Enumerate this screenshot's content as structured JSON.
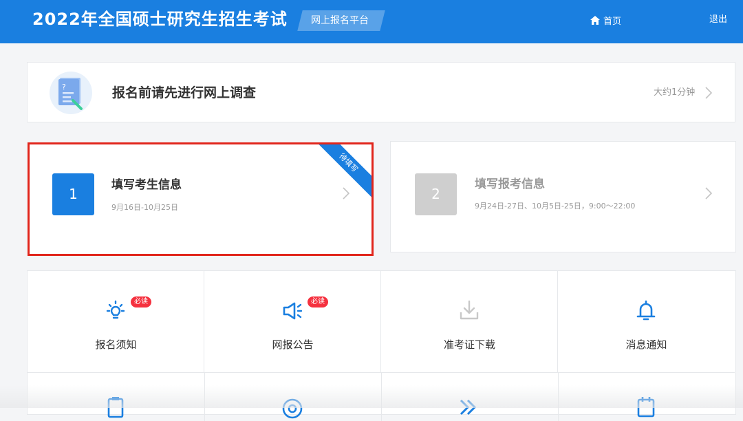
{
  "header": {
    "title": "2022年全国硕士研究生招生考试",
    "platform": "网上报名平台",
    "home": "首页",
    "logout": "退出",
    "brand_color": "#1a7fe0"
  },
  "survey": {
    "title": "报名前请先进行网上调查",
    "time": "大约1分钟"
  },
  "steps": [
    {
      "num": "1",
      "title": "填写考生信息",
      "date": "9月16日-10月25日",
      "ribbon": "待填写",
      "state": "active"
    },
    {
      "num": "2",
      "title": "填写报考信息",
      "date": "9月24日-27日、10月5日-25日，9:00～22:00",
      "state": "disabled"
    }
  ],
  "grid": {
    "items": [
      {
        "label": "报名须知",
        "icon": "lightbulb-icon",
        "badge": "必读"
      },
      {
        "label": "网报公告",
        "icon": "megaphone-icon",
        "badge": "必读"
      },
      {
        "label": "准考证下载",
        "icon": "download-icon"
      },
      {
        "label": "消息通知",
        "icon": "bell-icon"
      }
    ],
    "row2_icons": [
      "clipboard-icon",
      "target-icon",
      "fast-forward-icon",
      "calendar-icon"
    ]
  },
  "colors": {
    "accent": "#1a7fe0",
    "badge": "#f5313f",
    "highlight_border": "#e1251b",
    "disabled": "#cfcfcf"
  }
}
